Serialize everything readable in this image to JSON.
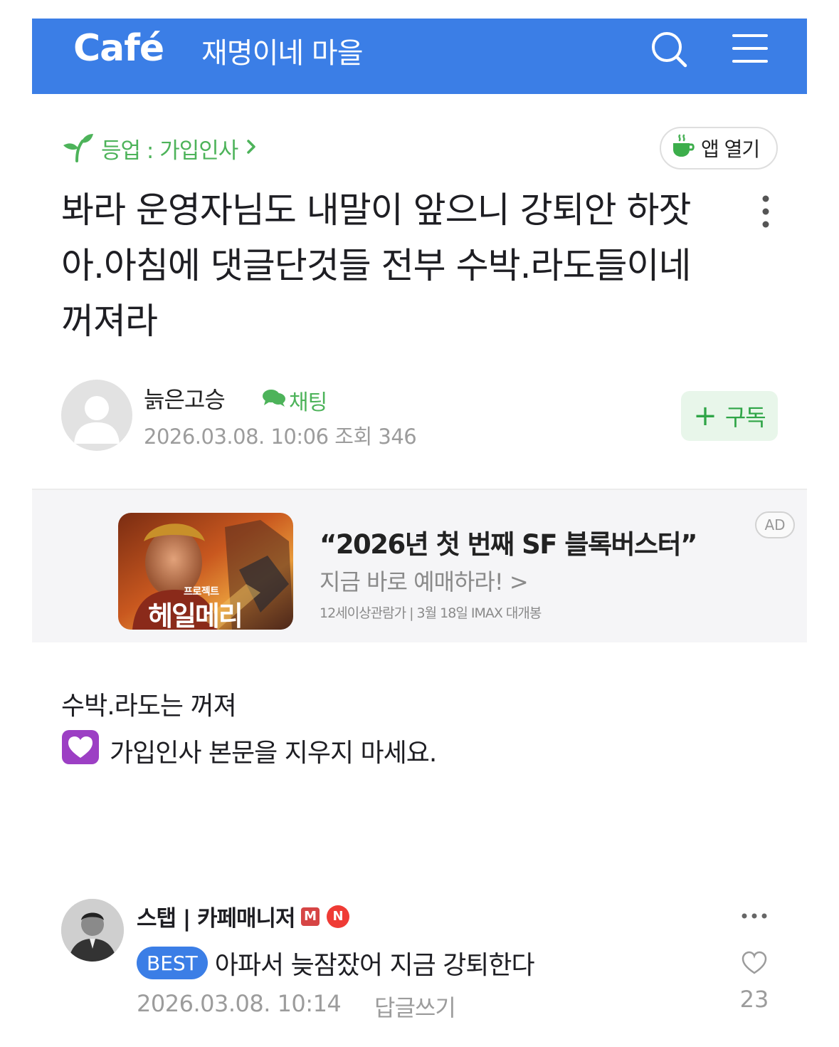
{
  "header": {
    "logo": "Café",
    "cafe_name": "재명이네 마을",
    "background": "#3b7ee6"
  },
  "breadcrumb": {
    "label": "등업 : 가입인사"
  },
  "app_open": {
    "label": "앱 열기"
  },
  "post": {
    "title": "봐라 운영자님도 내말이 앞으니 강퇴안 하잣아.아침에 댓글단것들 전부 수박.라도들이네 꺼져라",
    "author": "늙은고승",
    "chat_label": "채팅",
    "date": "2026.03.08. 10:06",
    "views_label": "조회",
    "views": "346",
    "subscribe_label": "구독",
    "body_line1": "수박.라도는 꺼져",
    "body_line2": "가입인사 본문을 지우지 마세요."
  },
  "ad": {
    "headline": "“2026년 첫 번째 SF 블록버스터”",
    "subline": "지금 바로 예매하라! >",
    "fineprint": "12세이상관람가 | 3월 18일 IMAX 대개봉",
    "badge": "AD",
    "poster_small": "프로젝트",
    "poster_title": "헤일메리"
  },
  "comment": {
    "author": "스탭 | 카페매니저",
    "badge_m": "M",
    "badge_n": "N",
    "best_label": "BEST",
    "text": "아파서 늦잠잤어 지금 강퇴한다",
    "date": "2026.03.08. 10:14",
    "reply_label": "답글쓰기",
    "likes": "23"
  },
  "colors": {
    "accent_green": "#4db35a",
    "primary_blue": "#3b7ee6",
    "muted_gray": "#9c9c9c"
  },
  "icons": [
    "search-icon",
    "menu-icon",
    "sprout-icon",
    "chevron-right-icon",
    "coffee-cup-icon",
    "more-vertical-icon",
    "chat-bubble-icon",
    "heart-icon",
    "more-horizontal-icon"
  ]
}
